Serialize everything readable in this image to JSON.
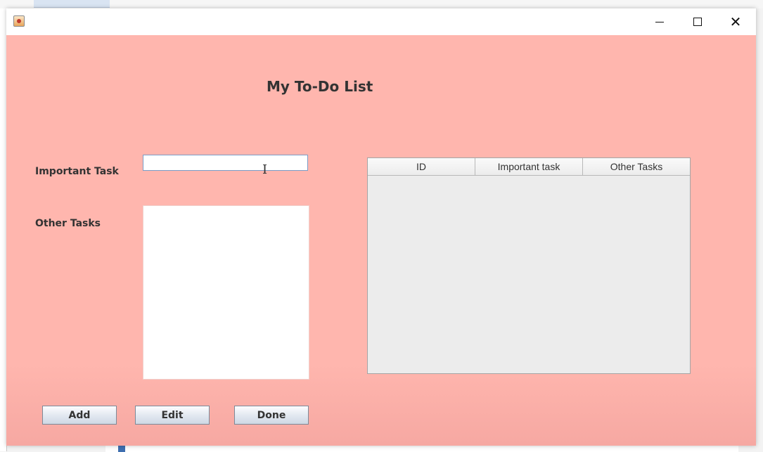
{
  "window": {
    "title": "",
    "controls": {
      "minimize": "minimize-icon",
      "maximize": "maximize-icon",
      "close": "close-icon"
    },
    "background_color": "#ffb6ae"
  },
  "form": {
    "title": "My To-Do List",
    "important_task_label": "Important Task",
    "important_task_value": "",
    "other_tasks_label": "Other Tasks",
    "other_tasks_value": ""
  },
  "table": {
    "columns": [
      "ID",
      "Important task",
      "Other Tasks"
    ],
    "rows": []
  },
  "buttons": {
    "add": "Add",
    "edit": "Edit",
    "done": "Done"
  }
}
